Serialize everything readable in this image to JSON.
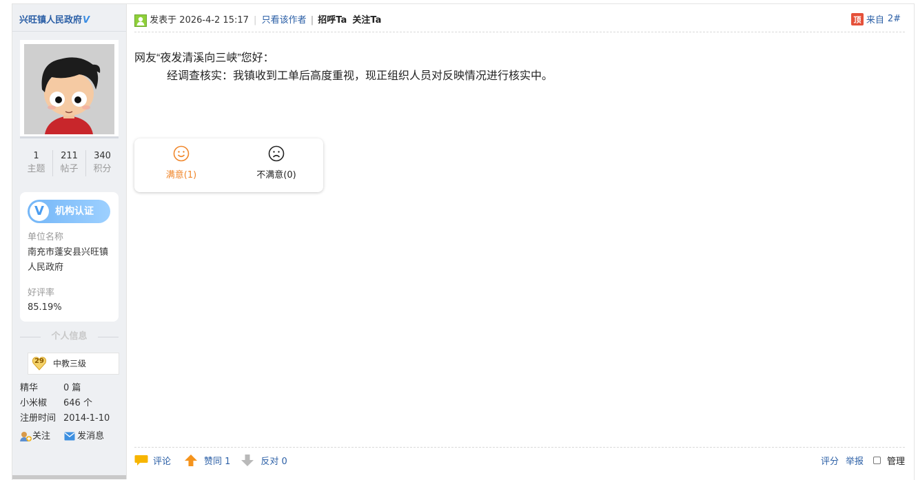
{
  "author": {
    "name": "兴旺镇人民政府",
    "verified_mark": "V",
    "stats": [
      {
        "value": "1",
        "label": "主题"
      },
      {
        "value": "211",
        "label": "帖子"
      },
      {
        "value": "340",
        "label": "积分"
      }
    ],
    "certification": {
      "badge_label": "机构认证",
      "unit_label": "单位名称",
      "unit_value": "南充市蓬安县兴旺镇人民政府",
      "rating_label": "好评率",
      "rating_value": "85.19%"
    },
    "info_divider": "个人信息",
    "level": {
      "number": "29",
      "name": "中教三级"
    },
    "properties": [
      {
        "key": "精华",
        "value": "0 篇"
      },
      {
        "key": "小米椒",
        "value": "646 个"
      },
      {
        "key": "注册时间",
        "value": "2014-1-10"
      }
    ],
    "follow_label": "关注",
    "message_label": "发消息"
  },
  "post": {
    "posted_prefix": "发表于",
    "posted_time": "2026-4-2 15:17",
    "only_author_label": "只看该作者",
    "greet_label": "招呼Ta",
    "follow_ta_label": "关注Ta",
    "source_label": "来自",
    "floor": "2#",
    "greeting_line": "网友“夜发清溪向三峡”您好：",
    "body_line": "经调查核实：我镇收到工单后高度重视，现正组织人员对反映情况进行核实中。"
  },
  "vote": {
    "satisfied_label": "满意(1)",
    "unsatisfied_label": "不满意(0)"
  },
  "footer": {
    "comment_label": "评论",
    "agree_label": "赞同 1",
    "oppose_label": "反对 0",
    "rate_label": "评分",
    "report_label": "举报",
    "manage_label": "管理"
  },
  "colors": {
    "link": "#2b5fa6",
    "satisfied": "#f0862a",
    "sidebar_bg": "#eef0f3",
    "cert_badge": "#74b6f7"
  }
}
